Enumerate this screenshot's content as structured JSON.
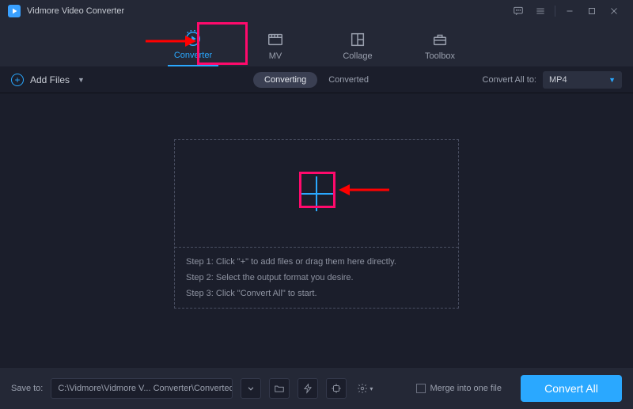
{
  "app": {
    "title": "Vidmore Video Converter"
  },
  "mainTabs": [
    {
      "key": "converter",
      "label": "Converter",
      "active": true
    },
    {
      "key": "mv",
      "label": "MV",
      "active": false
    },
    {
      "key": "collage",
      "label": "Collage",
      "active": false
    },
    {
      "key": "toolbox",
      "label": "Toolbox",
      "active": false
    }
  ],
  "toolrow": {
    "addFilesLabel": "Add Files",
    "midTabs": {
      "converting": "Converting",
      "converted": "Converted",
      "active": "converting"
    },
    "convertAllToLabel": "Convert All to:",
    "format": "MP4"
  },
  "dropzone": {
    "step1": "Step 1: Click \"+\" to add files or drag them here directly.",
    "step2": "Step 2: Select the output format you desire.",
    "step3": "Step 3: Click \"Convert All\" to start."
  },
  "bottombar": {
    "saveToLabel": "Save to:",
    "path": "C:\\Vidmore\\Vidmore V... Converter\\Converted",
    "mergeLabel": "Merge into one file",
    "convertAllBtn": "Convert All"
  },
  "colors": {
    "accent": "#2aa8ff",
    "highlight": "#ff0a6c",
    "bg": "#1b1e2b",
    "panel": "#242836"
  }
}
